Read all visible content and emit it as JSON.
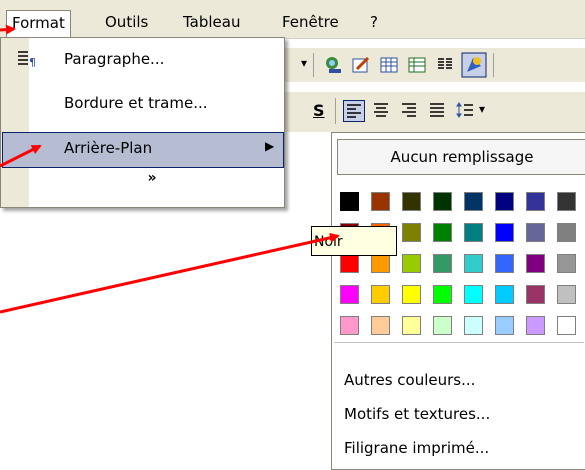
{
  "menubar": {
    "items": [
      {
        "label": "Format",
        "active": true
      },
      {
        "label": "Outils"
      },
      {
        "label": "Tableau"
      },
      {
        "label": "Fenêtre"
      },
      {
        "label": "?"
      }
    ]
  },
  "format_menu": {
    "items": [
      {
        "label": "Paragraphe..."
      },
      {
        "label": "Bordure et trame..."
      },
      {
        "label": "Arrière-Plan",
        "has_submenu": true,
        "highlighted": true
      }
    ],
    "expand_icon": "chevron-double-down-icon"
  },
  "submenu": {
    "no_fill_label": "Aucun remplissage",
    "palette": [
      [
        "#000000",
        "#993300",
        "#333300",
        "#003300",
        "#003366",
        "#000080",
        "#333399",
        "#333333"
      ],
      [
        "#800000",
        "#ff6600",
        "#808000",
        "#008000",
        "#008080",
        "#0000ff",
        "#666699",
        "#808080"
      ],
      [
        "#ff0000",
        "#ff9900",
        "#99cc00",
        "#339966",
        "#33cccc",
        "#3366ff",
        "#800080",
        "#969696"
      ],
      [
        "#ff00ff",
        "#ffcc00",
        "#ffff00",
        "#00ff00",
        "#00ffff",
        "#00ccff",
        "#993366",
        "#c0c0c0"
      ],
      [
        "#ff99cc",
        "#ffcc99",
        "#ffff99",
        "#ccffcc",
        "#ccffff",
        "#99ccff",
        "#cc99ff",
        "#ffffff"
      ]
    ],
    "items": [
      {
        "label": "Autres couleurs..."
      },
      {
        "label": "Motifs et textures..."
      },
      {
        "label": "Filigrane imprimé..."
      }
    ]
  },
  "tooltip": {
    "label": "Noir"
  },
  "toolbar": {
    "bold_s_label": "S"
  },
  "colors": {
    "arrow": "#ff0000",
    "menu_bg": "#ece9d8",
    "highlight": "#b6bdd2",
    "cyan": "#80ffff"
  }
}
